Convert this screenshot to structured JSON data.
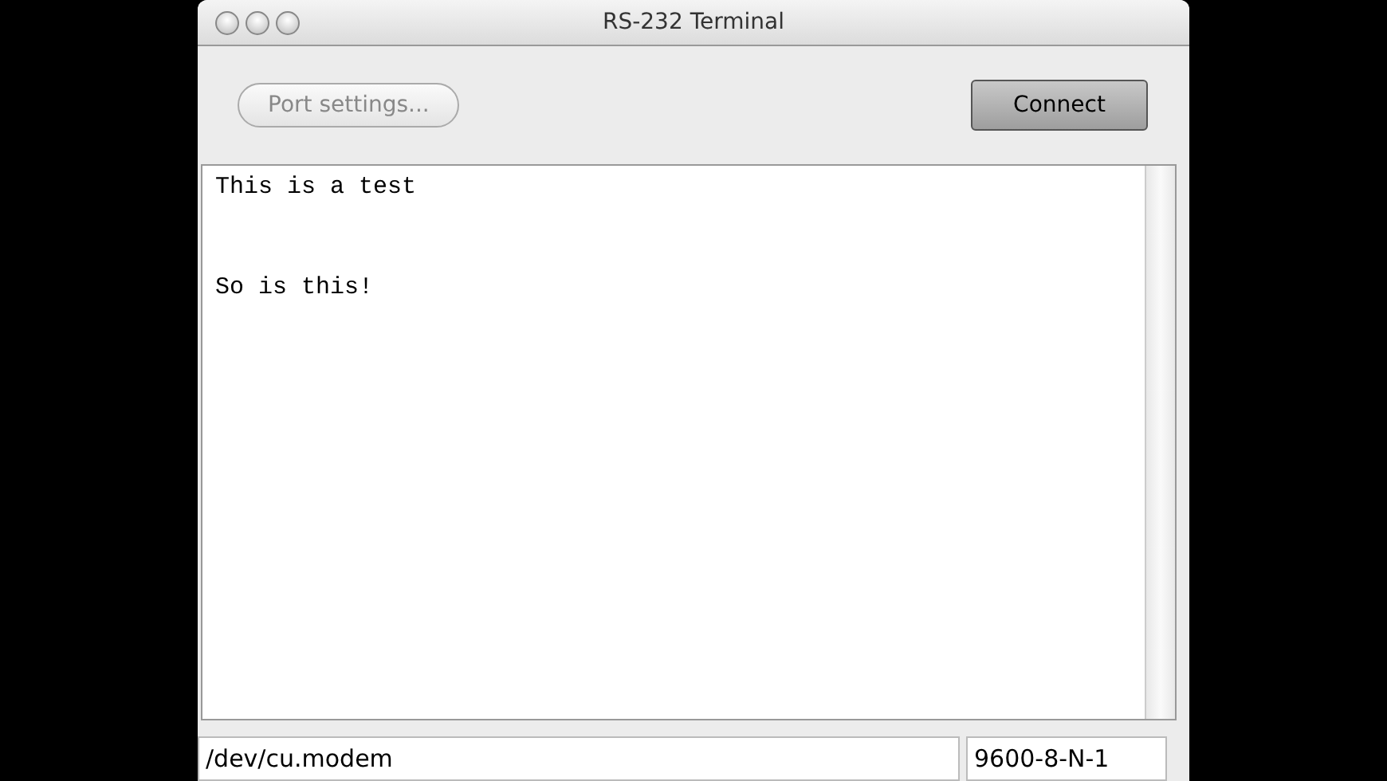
{
  "window": {
    "title": "RS-232 Terminal"
  },
  "buttons": [
    {
      "label": "Port settings...",
      "disabled": true,
      "default": false
    },
    {
      "label": "Connect",
      "disabled": false,
      "default": true
    }
  ],
  "terminal": {
    "text": "This is a test\n\n\nSo is this!"
  },
  "status_bar": {
    "port": "/dev/cu.modem",
    "settings": "9600-8-N-1"
  }
}
